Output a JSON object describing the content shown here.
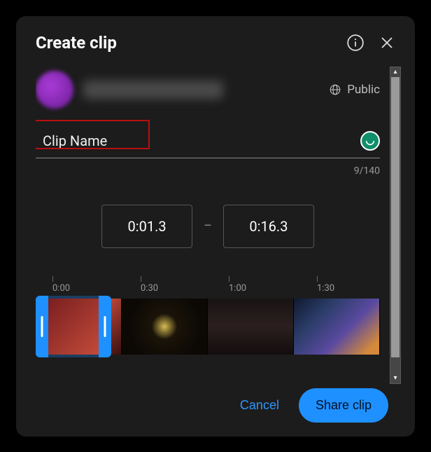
{
  "dialog": {
    "title": "Create clip"
  },
  "visibility": {
    "label": "Public"
  },
  "clip": {
    "name_value": "Clip Name",
    "char_count": "9/140",
    "start_time": "0:01.3",
    "end_time": "0:16.3"
  },
  "timeline": {
    "ticks": [
      "0:00",
      "0:30",
      "1:00",
      "1:30"
    ]
  },
  "buttons": {
    "cancel": "Cancel",
    "share": "Share clip"
  },
  "icons": {
    "info": "info-icon",
    "close": "close-icon",
    "globe": "globe-icon"
  }
}
